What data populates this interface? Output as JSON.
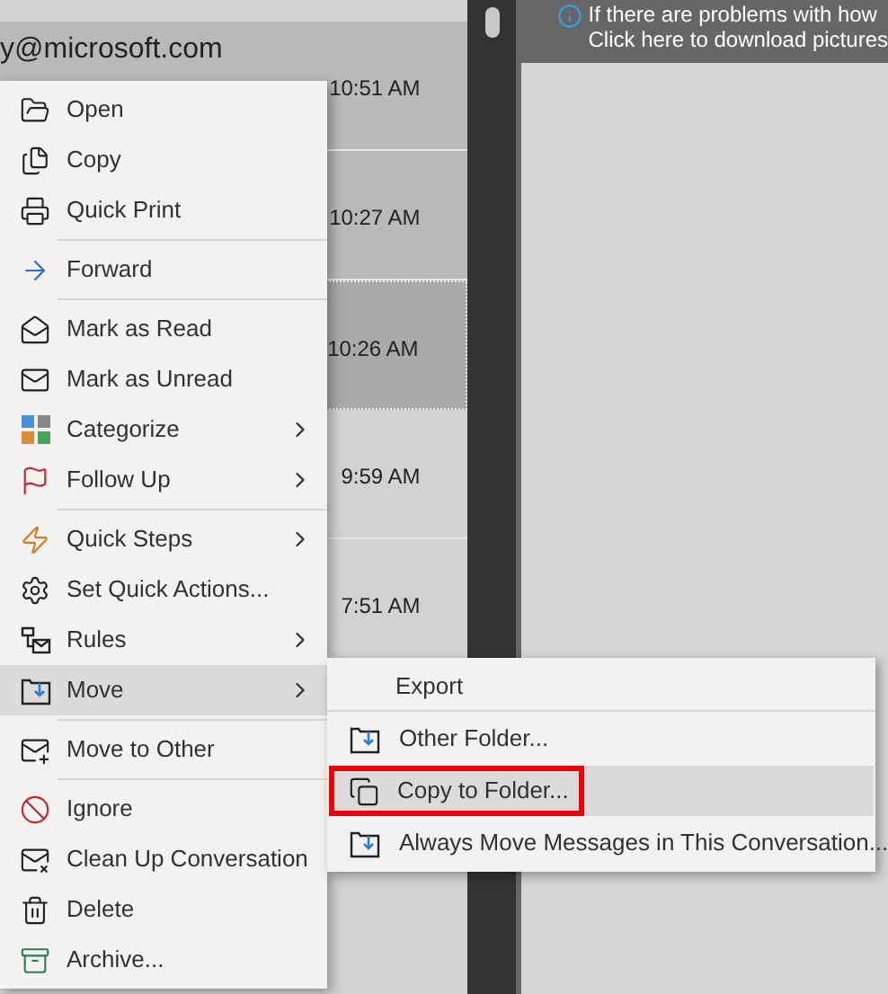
{
  "message_list": [
    {
      "sender": "y@microsoft.com",
      "time": "10:51 AM",
      "selected": true,
      "focused": false
    },
    {
      "time": "10:27 AM",
      "selected": true,
      "focused": false
    },
    {
      "time": "10:26 AM",
      "selected": true,
      "focused": true
    },
    {
      "time": "9:59 AM",
      "selected": false,
      "focused": false
    },
    {
      "time": "7:51 AM",
      "selected": false,
      "focused": false
    }
  ],
  "reading_pane": {
    "info_bar": [
      "If there are problems with how",
      "Click here to download pictures"
    ]
  },
  "context_menu": {
    "groups": [
      [
        {
          "label": "Open",
          "submenu": false,
          "selected": false
        },
        {
          "label": "Copy",
          "submenu": false,
          "selected": false
        },
        {
          "label": "Quick Print",
          "submenu": false,
          "selected": false
        }
      ],
      [
        {
          "label": "Forward",
          "submenu": false,
          "selected": false
        }
      ],
      [
        {
          "label": "Mark as Read",
          "submenu": false,
          "selected": false
        },
        {
          "label": "Mark as Unread",
          "submenu": false,
          "selected": false
        },
        {
          "label": "Categorize",
          "submenu": true,
          "selected": false
        },
        {
          "label": "Follow Up",
          "submenu": true,
          "selected": false
        }
      ],
      [
        {
          "label": "Quick Steps",
          "submenu": true,
          "selected": false
        },
        {
          "label": "Set Quick Actions...",
          "submenu": false,
          "selected": false
        },
        {
          "label": "Rules",
          "submenu": true,
          "selected": false
        },
        {
          "label": "Move",
          "submenu": true,
          "selected": true
        }
      ],
      [
        {
          "label": "Move to Other",
          "submenu": false,
          "selected": false
        }
      ],
      [
        {
          "label": "Ignore",
          "submenu": false,
          "selected": false
        },
        {
          "label": "Clean Up Conversation",
          "submenu": false,
          "selected": false
        },
        {
          "label": "Delete",
          "submenu": false,
          "selected": false
        },
        {
          "label": "Archive...",
          "submenu": false,
          "selected": false
        }
      ]
    ]
  },
  "submenu": {
    "header": "Export",
    "items": [
      {
        "label": "Other Folder...",
        "selected": false,
        "highlighted": false
      },
      {
        "label": "Copy to Folder...",
        "selected": true,
        "highlighted": true
      },
      {
        "label": "Always Move Messages in This Conversation...",
        "selected": false,
        "highlighted": false
      }
    ]
  }
}
